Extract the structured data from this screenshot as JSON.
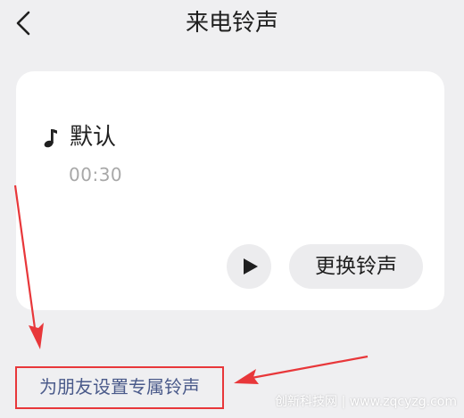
{
  "header": {
    "title": "来电铃声",
    "back_icon": "chevron-left-icon"
  },
  "ringtone": {
    "icon": "music-note-icon",
    "name": "默认",
    "duration": "00:30",
    "play_icon": "play-icon",
    "change_label": "更换铃声"
  },
  "exclusive": {
    "label": "为朋友设置专属铃声"
  },
  "annotation": {
    "color": "#e8373a"
  },
  "watermark": {
    "text": "创新科技网 | www.zqcyzg.com"
  },
  "colors": {
    "background": "#efeff1",
    "card": "#ffffff",
    "link": "#4a5a8a",
    "muted": "#a8a8a8"
  }
}
